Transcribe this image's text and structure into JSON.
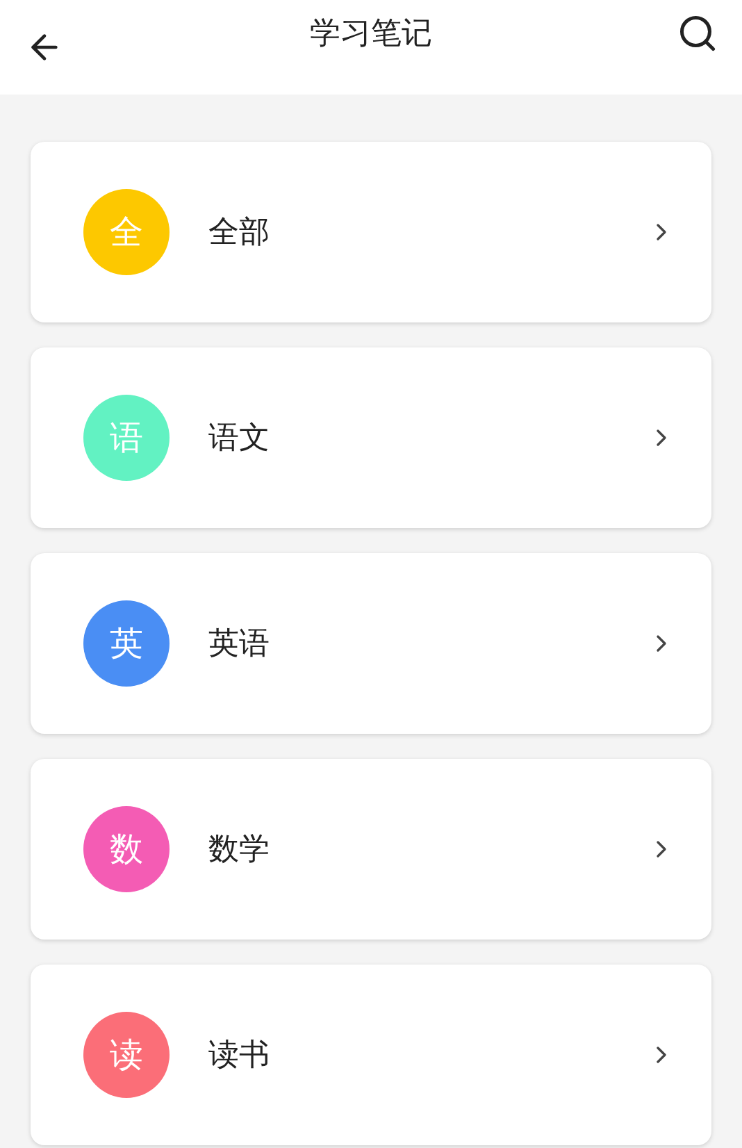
{
  "header": {
    "title": "学习笔记"
  },
  "categories": [
    {
      "badge": "全",
      "label": "全部",
      "color": "#fdc800"
    },
    {
      "badge": "语",
      "label": "语文",
      "color": "#62f2c2"
    },
    {
      "badge": "英",
      "label": "英语",
      "color": "#4a8ef4"
    },
    {
      "badge": "数",
      "label": "数学",
      "color": "#f45cb4"
    },
    {
      "badge": "读",
      "label": "读书",
      "color": "#fb6e78"
    }
  ]
}
